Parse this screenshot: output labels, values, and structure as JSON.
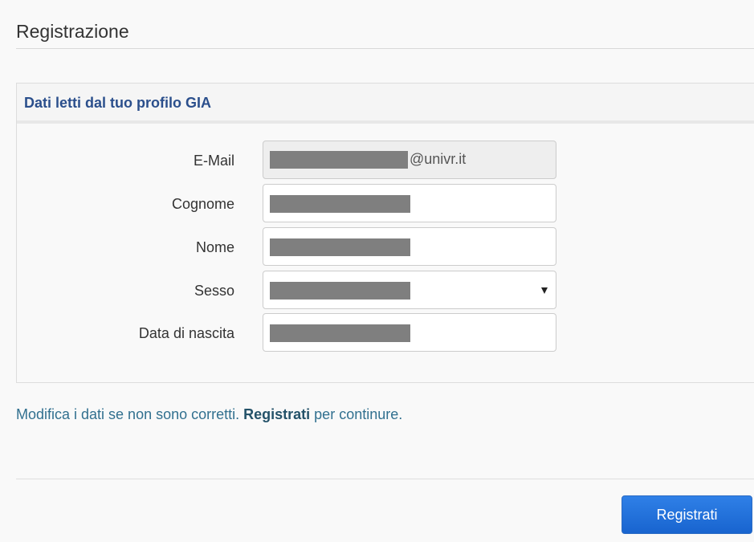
{
  "page": {
    "title": "Registrazione"
  },
  "panel": {
    "heading": "Dati letti dal tuo profilo GIA",
    "fields": [
      {
        "label": "E-Mail",
        "value_suffix": "@univr.it",
        "readonly": true
      },
      {
        "label": "Cognome",
        "value": ""
      },
      {
        "label": "Nome",
        "value": ""
      },
      {
        "label": "Sesso",
        "value": ""
      },
      {
        "label": "Data di nascita",
        "value": ""
      }
    ]
  },
  "help": {
    "before": "Modifica i dati se non sono corretti. ",
    "strong": "Registrati",
    "after": " per continure."
  },
  "actions": {
    "submit_label": "Registrati"
  },
  "colors": {
    "accent": "#2b4f8c",
    "help_text": "#31708f",
    "button": "#1d6fd8"
  }
}
